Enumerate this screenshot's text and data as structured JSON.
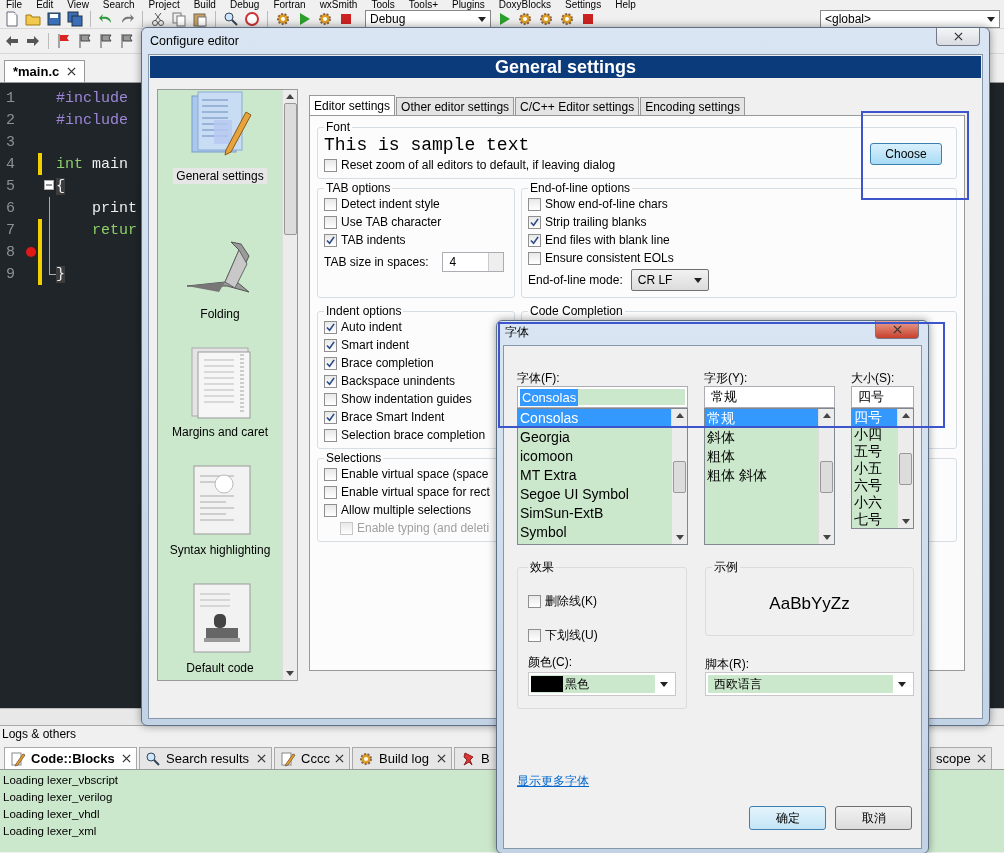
{
  "menu": [
    "File",
    "Edit",
    "View",
    "Search",
    "Project",
    "Build",
    "Debug",
    "Fortran",
    "wxSmith",
    "Tools",
    "Tools+",
    "Plugins",
    "DoxyBlocks",
    "Settings",
    "Help"
  ],
  "toolbar": {
    "build_target": "Debug",
    "scope": "<global>"
  },
  "editor_tabs": [
    {
      "label": "*main.c",
      "selected": true
    }
  ],
  "editor_lines": [
    {
      "number": "1",
      "tokens": [
        {
          "text": "#include",
          "kind": "directive"
        }
      ],
      "changed": false,
      "breakpoint": false,
      "fold": false
    },
    {
      "number": "2",
      "tokens": [
        {
          "text": "#include",
          "kind": "directive"
        }
      ],
      "changed": false,
      "breakpoint": false,
      "fold": false
    },
    {
      "number": "3",
      "changed": false,
      "breakpoint": false,
      "fold": false
    },
    {
      "number": "4",
      "tokens": [
        {
          "text": "int",
          "kind": "keyword"
        },
        {
          "text": " main",
          "kind": "plain"
        }
      ],
      "changed": true,
      "breakpoint": false,
      "fold": false
    },
    {
      "number": "5",
      "tokens": [
        {
          "text": "{",
          "kind": "brace"
        }
      ],
      "changed": false,
      "breakpoint": false,
      "fold": true
    },
    {
      "number": "6",
      "tokens": [
        {
          "text": "    print",
          "kind": "plain"
        }
      ],
      "changed": false,
      "breakpoint": false,
      "fold": false
    },
    {
      "number": "7",
      "tokens": [
        {
          "text": "    retur",
          "kind": "keyword"
        }
      ],
      "changed": true,
      "breakpoint": false,
      "fold": false
    },
    {
      "number": "8",
      "changed": true,
      "breakpoint": true,
      "fold": false
    },
    {
      "number": "9",
      "tokens": [
        {
          "text": "}",
          "kind": "brace"
        }
      ],
      "changed": true,
      "breakpoint": false,
      "fold": false
    }
  ],
  "logs": {
    "title": "Logs & others",
    "tabs": [
      {
        "label": "Code::Blocks",
        "selected": true,
        "kind": "pencil"
      },
      {
        "label": "Search results",
        "selected": false,
        "kind": "search"
      },
      {
        "label": "Cccc",
        "selected": false,
        "kind": "pencil"
      },
      {
        "label": "Build log",
        "selected": false,
        "kind": "gear"
      },
      {
        "label": "B",
        "selected": false,
        "kind": "pin"
      },
      {
        "label": "scope",
        "selected": false,
        "kind": "none"
      }
    ],
    "lines": [
      "Loading lexer_vbscript",
      "Loading lexer_verilog",
      "Loading lexer_vhdl",
      "Loading lexer_xml"
    ]
  },
  "configure_dialog": {
    "title": "Configure editor",
    "header": "General settings",
    "categories": [
      {
        "label": "General settings",
        "selected": true,
        "kind": "general"
      },
      {
        "label": "Folding",
        "selected": false,
        "kind": "folding"
      },
      {
        "label": "Margins and caret",
        "selected": false,
        "kind": "margins"
      },
      {
        "label": "Syntax highlighting",
        "selected": false,
        "kind": "syntax"
      },
      {
        "label": "Default code",
        "selected": false,
        "kind": "default_code"
      }
    ],
    "tabs": [
      {
        "label": "Editor settings",
        "selected": true
      },
      {
        "label": "Other editor settings",
        "selected": false
      },
      {
        "label": "C/C++ Editor settings",
        "selected": false
      },
      {
        "label": "Encoding settings",
        "selected": false
      }
    ],
    "font": {
      "title": "Font",
      "sample": "This is sample text",
      "reset": {
        "label": "Reset zoom of all editors to default, if leaving dialog",
        "checked": false
      },
      "button": "Choose"
    },
    "tab_options": {
      "title": "TAB options",
      "options": [
        {
          "label": "Detect indent style",
          "checked": false
        },
        {
          "label": "Use TAB character",
          "checked": false
        },
        {
          "label": "TAB indents",
          "checked": true
        }
      ],
      "size_label": "TAB size in spaces:",
      "size_value": "4"
    },
    "eol_options": {
      "title": "End-of-line options",
      "options": [
        {
          "label": "Show end-of-line chars",
          "checked": false
        },
        {
          "label": "Strip trailing blanks",
          "checked": true
        },
        {
          "label": "End files with blank line",
          "checked": true
        },
        {
          "label": "Ensure consistent EOLs",
          "checked": false
        }
      ],
      "mode_label": "End-of-line mode:",
      "mode_value": "CR LF"
    },
    "indent_options": {
      "title": "Indent options",
      "options": [
        {
          "label": "Auto indent",
          "checked": true
        },
        {
          "label": "Smart indent",
          "checked": true
        },
        {
          "label": "Brace completion",
          "checked": true
        },
        {
          "label": "Backspace unindents",
          "checked": true
        },
        {
          "label": "Show indentation guides",
          "checked": false
        },
        {
          "label": "Brace Smart Indent",
          "checked": true
        },
        {
          "label": "Selection brace completion",
          "checked": false
        }
      ]
    },
    "code_completion": {
      "title": "Code Completion"
    },
    "selections": {
      "title": "Selections",
      "options": [
        {
          "label": "Enable virtual space (space",
          "checked": false,
          "disabled": false
        },
        {
          "label": "Enable virtual space for rect",
          "checked": false,
          "disabled": false
        },
        {
          "label": "Allow multiple selections",
          "checked": false,
          "disabled": false
        },
        {
          "label": "Enable typing (and deleti",
          "checked": false,
          "disabled": true
        }
      ]
    }
  },
  "font_dialog": {
    "title": "字体",
    "font": {
      "label": "字体(F):",
      "value": "Consolas",
      "items": [
        {
          "label": "Consolas",
          "selected": true
        },
        {
          "label": "Georgia",
          "selected": false
        },
        {
          "label": "icomoon",
          "selected": false
        },
        {
          "label": "MT Extra",
          "selected": false
        },
        {
          "label": "Segoe UI Symbol",
          "selected": false
        },
        {
          "label": "SimSun-ExtB",
          "selected": false
        },
        {
          "label": "Symbol",
          "selected": false
        }
      ]
    },
    "style": {
      "label": "字形(Y):",
      "value": "常规",
      "items": [
        {
          "label": "常规",
          "selected": true
        },
        {
          "label": "斜体",
          "selected": false
        },
        {
          "label": "粗体",
          "selected": false
        },
        {
          "label": "粗体 斜体",
          "selected": false
        }
      ]
    },
    "size": {
      "label": "大小(S):",
      "value": "四号",
      "items": [
        {
          "label": "四号",
          "selected": true
        },
        {
          "label": "小四",
          "selected": false
        },
        {
          "label": "五号",
          "selected": false
        },
        {
          "label": "小五",
          "selected": false
        },
        {
          "label": "六号",
          "selected": false
        },
        {
          "label": "小六",
          "selected": false
        },
        {
          "label": "七号",
          "selected": false
        }
      ]
    },
    "effects": {
      "title": "效果",
      "options": [
        {
          "label": "删除线(K)",
          "checked": false
        },
        {
          "label": "下划线(U)",
          "checked": false
        }
      ],
      "color_label": "颜色(C):",
      "color_value": "黑色",
      "color": "#000000"
    },
    "sample": {
      "title": "示例",
      "text": "AaBbYyZz"
    },
    "script": {
      "label": "脚本(R):",
      "value": "西欧语言"
    },
    "link": "显示更多字体",
    "buttons": [
      {
        "label": "确定",
        "default": true
      },
      {
        "label": "取消",
        "default": false
      }
    ]
  }
}
